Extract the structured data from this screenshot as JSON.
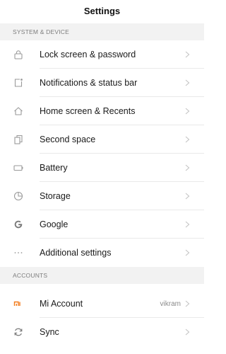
{
  "header": {
    "title": "Settings"
  },
  "sections": [
    {
      "title": "SYSTEM & DEVICE",
      "items": [
        {
          "label": "Lock screen & password",
          "icon": "lock-icon"
        },
        {
          "label": "Notifications & status bar",
          "icon": "notification-icon"
        },
        {
          "label": "Home screen & Recents",
          "icon": "home-icon"
        },
        {
          "label": "Second space",
          "icon": "second-space-icon"
        },
        {
          "label": "Battery",
          "icon": "battery-icon"
        },
        {
          "label": "Storage",
          "icon": "storage-icon"
        },
        {
          "label": "Google",
          "icon": "google-icon"
        },
        {
          "label": "Additional settings",
          "icon": "more-icon"
        }
      ]
    },
    {
      "title": "ACCOUNTS",
      "items": [
        {
          "label": "Mi Account",
          "value": "vikram",
          "icon": "mi-logo-icon"
        },
        {
          "label": "Sync",
          "icon": "sync-icon"
        }
      ]
    }
  ],
  "colors": {
    "icon_gray": "#9a9a9a",
    "mi_orange": "#f27b1b",
    "chevron": "#c4c4c4"
  }
}
